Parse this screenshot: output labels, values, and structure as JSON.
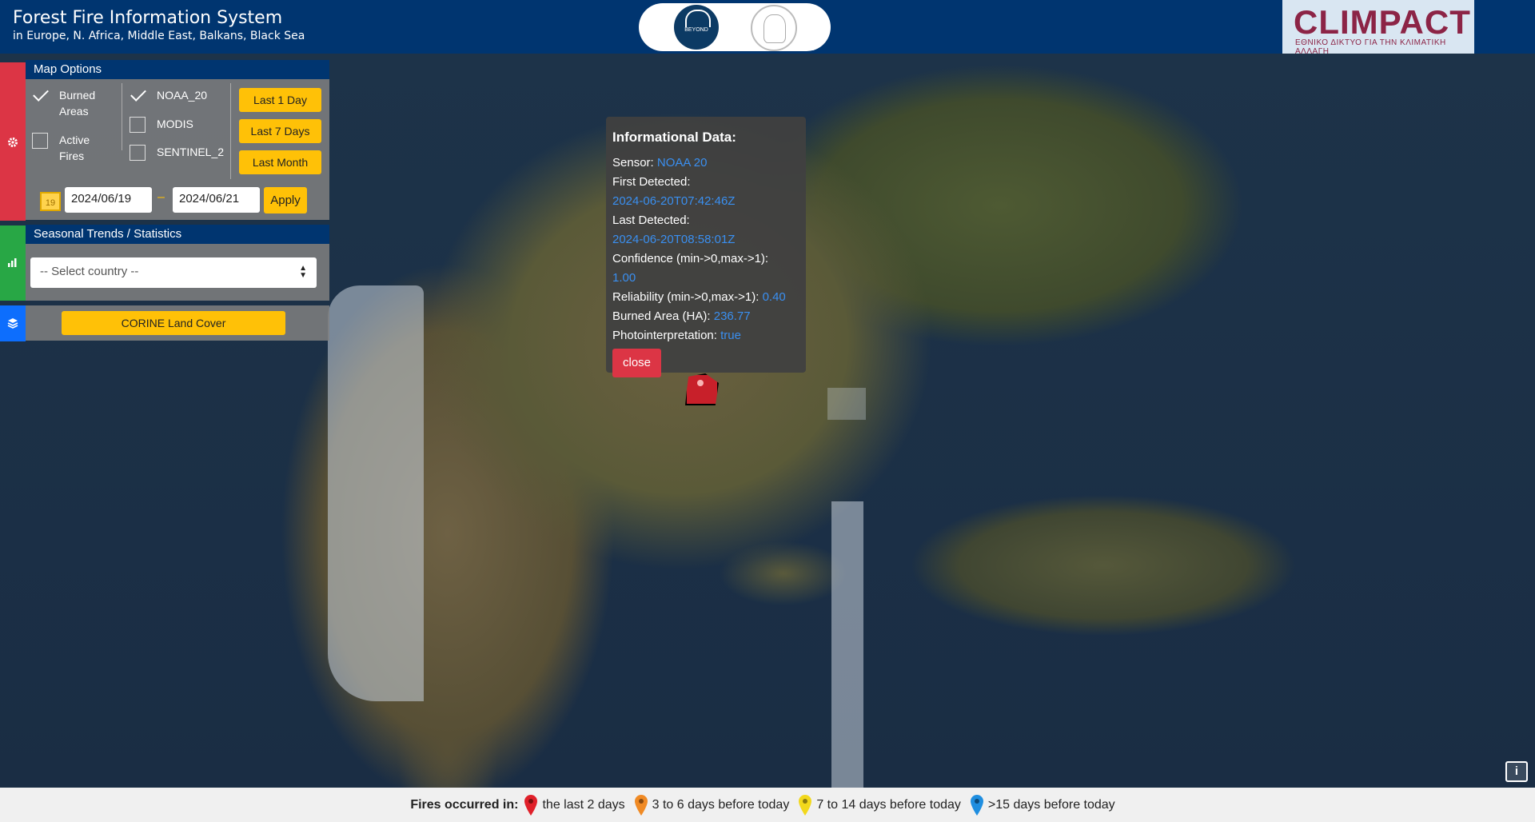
{
  "header": {
    "title": "Forest Fire Information System",
    "subtitle": "in Europe, N. Africa, Middle East, Balkans, Black Sea",
    "beyond_logo_text": "BEYOND",
    "climpact_name": "CLIMPACT",
    "climpact_tagline": "ΕΘΝΙΚΟ ΔΙΚΤΥΟ ΓΙΑ ΤΗΝ ΚΛΙΜΑΤΙΚΗ ΑΛΛΑΓΗ"
  },
  "map_options": {
    "title": "Map Options",
    "layers": [
      {
        "label_line1": "Burned",
        "label_line2": "Areas",
        "checked": true
      },
      {
        "label_line1": "Active",
        "label_line2": "Fires",
        "checked": false
      }
    ],
    "sensors": [
      {
        "label": "NOAA_20",
        "checked": true
      },
      {
        "label": "MODIS",
        "checked": false
      },
      {
        "label": "SENTINEL_2",
        "checked": false
      }
    ],
    "range_buttons": [
      "Last 1 Day",
      "Last 7 Days",
      "Last Month"
    ],
    "calendar_day": "19",
    "date_from": "2024/06/19",
    "date_separator": "–",
    "date_to": "2024/06/21",
    "apply_label": "Apply"
  },
  "seasonal": {
    "title": "Seasonal Trends / Statistics",
    "select_value": "-- Select country --"
  },
  "layers": {
    "corine_label": "CORINE Land Cover"
  },
  "popup": {
    "heading": "Informational Data:",
    "sensor_label": "Sensor:",
    "sensor_value": "NOAA 20",
    "first_label": "First Detected:",
    "first_value": "2024-06-20T07:42:46Z",
    "last_label": "Last Detected:",
    "last_value": "2024-06-20T08:58:01Z",
    "confidence_label": "Confidence (min->0,max->1):",
    "confidence_value": "1.00",
    "reliability_label": "Reliability (min->0,max->1):",
    "reliability_value": "0.40",
    "burned_label": "Burned Area (HA):",
    "burned_value": "236.77",
    "photo_label": "Photointerpretation:",
    "photo_value": "true",
    "close_label": "close"
  },
  "info_button": "i",
  "legend": {
    "label": "Fires occurred in:",
    "items": [
      {
        "text": "the last 2 days",
        "color": "#e0202a"
      },
      {
        "text": "3 to 6 days before today",
        "color": "#f08a24"
      },
      {
        "text": "7 to 14 days before today",
        "color": "#f2d81c"
      },
      {
        "text": ">15 days before today",
        "color": "#1f8ee0"
      }
    ]
  },
  "colors": {
    "header_bg": "#003570",
    "options_tab": "#dc3545",
    "stats_tab": "#28a745",
    "layers_tab": "#0d6efd",
    "button_yellow": "#ffc107",
    "popup_value": "#3a8ff0",
    "fire_polygon": "#c8202a"
  },
  "icons": [
    "gear-icon",
    "bar-chart-icon",
    "layers-icon",
    "calendar-icon",
    "map-pin-icon",
    "info-icon"
  ]
}
